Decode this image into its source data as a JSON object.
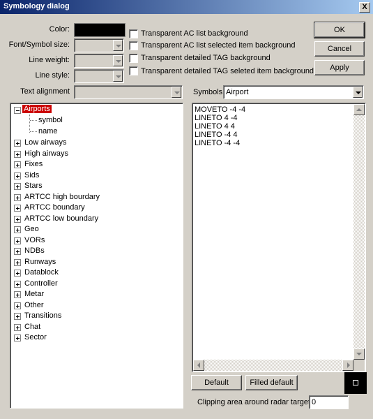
{
  "window": {
    "title": "Symbology dialog",
    "close": "X"
  },
  "form": {
    "color_label": "Color:",
    "font_size_label": "Font/Symbol size:",
    "line_weight_label": "Line weight:",
    "line_style_label": "Line style:",
    "text_alignment_label": "Text alignment",
    "color_value": "#000000"
  },
  "checkboxes": [
    {
      "label": "Transparent AC list background",
      "checked": false
    },
    {
      "label": "Transparent AC list selected item background",
      "checked": false
    },
    {
      "label": "Transparent detailed TAG background",
      "checked": false
    },
    {
      "label": "Transparent detailed TAG seleted item background",
      "checked": false
    }
  ],
  "buttons": {
    "ok": "OK",
    "cancel": "Cancel",
    "apply": "Apply",
    "default": "Default",
    "filled_default": "Filled default"
  },
  "symbols": {
    "label": "Symbols",
    "selected": "Airport"
  },
  "symbol_lines": [
    "MOVETO -4 -4",
    "LINETO 4 -4",
    "LINETO 4 4",
    "LINETO -4 4",
    "LINETO -4 -4"
  ],
  "tree": {
    "root": "Airports",
    "root_children": [
      "symbol",
      "name"
    ],
    "items": [
      "Low airways",
      "High airways",
      "Fixes",
      "Sids",
      "Stars",
      "ARTCC high bourdary",
      "ARTCC boundary",
      "ARTCC low boundary",
      "Geo",
      "VORs",
      "NDBs",
      "Runways",
      "Datablock",
      "Controller",
      "Metar",
      "Other",
      "Transitions",
      "Chat",
      "Sector"
    ]
  },
  "clipping": {
    "label": "Clipping area around radar targets",
    "value": "0"
  }
}
